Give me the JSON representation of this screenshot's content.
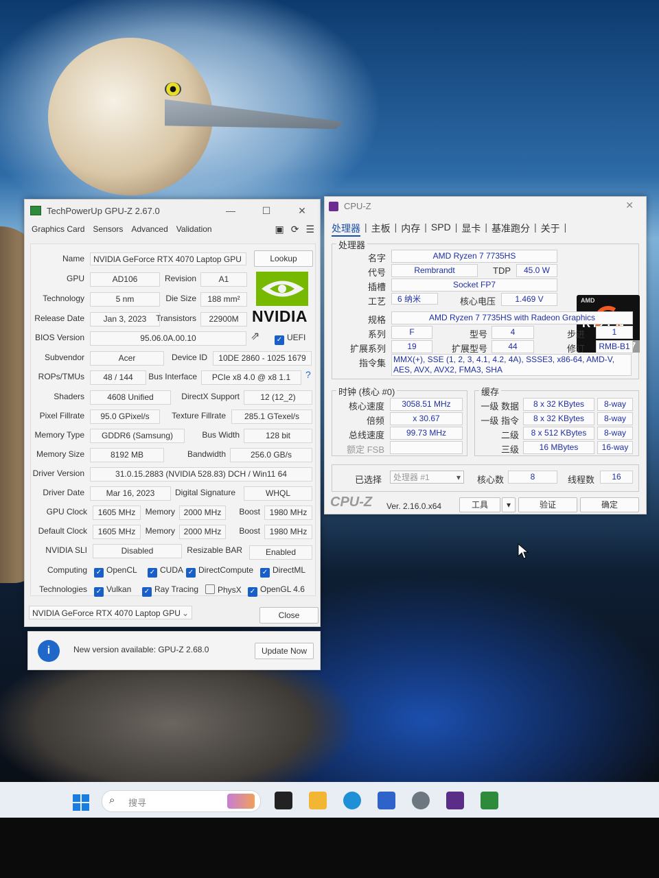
{
  "gpuz": {
    "title": "TechPowerUp GPU-Z 2.67.0",
    "tabs": [
      "Graphics Card",
      "Sensors",
      "Advanced",
      "Validation"
    ],
    "lookup_label": "Lookup",
    "name_label": "Name",
    "name": "NVIDIA GeForce RTX 4070 Laptop GPU",
    "gpu_label": "GPU",
    "gpu": "AD106",
    "revision_label": "Revision",
    "revision": "A1",
    "technology_label": "Technology",
    "technology": "5 nm",
    "die_size_label": "Die Size",
    "die_size": "188 mm²",
    "release_date_label": "Release Date",
    "release_date": "Jan 3, 2023",
    "transistors_label": "Transistors",
    "transistors": "22900M",
    "bios_label": "BIOS Version",
    "bios": "95.06.0A.00.10",
    "uefi_label": "UEFI",
    "subvendor_label": "Subvendor",
    "subvendor": "Acer",
    "device_id_label": "Device ID",
    "device_id": "10DE 2860 - 1025 1679",
    "rops_label": "ROPs/TMUs",
    "rops": "48 / 144",
    "bus_interface_label": "Bus Interface",
    "bus_interface": "PCIe x8 4.0 @ x8 1.1",
    "help": "?",
    "shaders_label": "Shaders",
    "shaders": "4608 Unified",
    "directx_label": "DirectX Support",
    "directx": "12 (12_2)",
    "pixel_fillrate_label": "Pixel Fillrate",
    "pixel_fillrate": "95.0 GPixel/s",
    "texture_fillrate_label": "Texture Fillrate",
    "texture_fillrate": "285.1 GTexel/s",
    "memory_type_label": "Memory Type",
    "memory_type": "GDDR6 (Samsung)",
    "bus_width_label": "Bus Width",
    "bus_width": "128 bit",
    "memory_size_label": "Memory Size",
    "memory_size": "8192 MB",
    "bandwidth_label": "Bandwidth",
    "bandwidth": "256.0 GB/s",
    "driver_version_label": "Driver Version",
    "driver_version": "31.0.15.2883 (NVIDIA 528.83) DCH / Win11 64",
    "driver_date_label": "Driver Date",
    "driver_date": "Mar 16, 2023",
    "digital_signature_label": "Digital Signature",
    "digital_signature": "WHQL",
    "gpu_clock_label": "GPU Clock",
    "gpu_clock": "1605 MHz",
    "memory_label": "Memory",
    "memory_clock": "2000 MHz",
    "boost_label": "Boost",
    "boost_clock": "1980 MHz",
    "default_clock_label": "Default Clock",
    "default_clock": "1605 MHz",
    "default_memory_clock": "2000 MHz",
    "default_boost_clock": "1980 MHz",
    "sli_label": "NVIDIA SLI",
    "sli": "Disabled",
    "resizable_bar_label": "Resizable BAR",
    "resizable_bar": "Enabled",
    "computing_label": "Computing",
    "technologies_label": "Technologies",
    "computing": [
      {
        "label": "OpenCL",
        "checked": true
      },
      {
        "label": "CUDA",
        "checked": true
      },
      {
        "label": "DirectCompute",
        "checked": true
      },
      {
        "label": "DirectML",
        "checked": true
      }
    ],
    "technologies": [
      {
        "label": "Vulkan",
        "checked": true
      },
      {
        "label": "Ray Tracing",
        "checked": true
      },
      {
        "label": "PhysX",
        "checked": false
      },
      {
        "label": "OpenGL 4.6",
        "checked": true
      }
    ],
    "selected_gpu": "NVIDIA GeForce RTX 4070 Laptop GPU",
    "close_label": "Close",
    "brand": "NVIDIA"
  },
  "notification": {
    "text": "New version available: GPU-Z 2.68.0",
    "button": "Update Now",
    "icon_glyph": "i"
  },
  "cpuz": {
    "title": "CPU-Z",
    "tabs": [
      "处理器",
      "主板",
      "内存",
      "SPD",
      "显卡",
      "基准跑分",
      "关于"
    ],
    "processor_group": "处理器",
    "name_label": "名字",
    "name": "AMD Ryzen 7 7735HS",
    "codename_label": "代号",
    "codename": "Rembrandt",
    "tdp_label": "TDP",
    "tdp": "45.0 W",
    "package_label": "插槽",
    "package": "Socket FP7",
    "technology_label": "工艺",
    "technology": "6 纳米",
    "voltage_label": "核心电压",
    "voltage": "1.469 V",
    "spec_label": "规格",
    "spec": "AMD Ryzen 7 7735HS with Radeon Graphics",
    "family_label": "系列",
    "family": "F",
    "model_label": "型号",
    "model": "4",
    "stepping_label": "步进",
    "stepping": "1",
    "ext_family_label": "扩展系列",
    "ext_family": "19",
    "ext_model_label": "扩展型号",
    "ext_model": "44",
    "revision_label": "修订",
    "revision": "RMB-B1",
    "instructions_label": "指令集",
    "instructions_line1": "MMX(+), SSE (1, 2, 3, 4.1, 4.2, 4A), SSSE3, x86-64, AMD-V,",
    "instructions_line2": "AES, AVX, AVX2, FMA3, SHA",
    "clocks_group": "时钟 (核心 #0)",
    "core_speed_label": "核心速度",
    "core_speed": "3058.51 MHz",
    "multiplier_label": "倍频",
    "multiplier": "x 30.67",
    "bus_speed_label": "总线速度",
    "bus_speed": "99.73 MHz",
    "rated_fsb_label": "额定 FSB",
    "rated_fsb": "",
    "cache_group": "缓存",
    "l1d_label": "一级 数据",
    "l1d": "8 x 32 KBytes",
    "l1d_way": "8-way",
    "l1i_label": "一级 指令",
    "l1i": "8 x 32 KBytes",
    "l1i_way": "8-way",
    "l2_label": "二级",
    "l2": "8 x 512 KBytes",
    "l2_way": "8-way",
    "l3_label": "三级",
    "l3": "16 MBytes",
    "l3_way": "16-way",
    "selection_label": "已选择",
    "selection": "处理器 #1",
    "cores_label": "核心数",
    "cores": "8",
    "threads_label": "线程数",
    "threads": "16",
    "brand": "CPU-Z",
    "version": "Ver. 2.16.0.x64",
    "tools_label": "工具",
    "validate_label": "验证",
    "ok_label": "确定",
    "logo_amd": "AMD",
    "logo_ryzen": "RYZEN",
    "logo_num": "7"
  },
  "taskbar": {
    "search_placeholder": "搜寻"
  },
  "colors": {
    "nvidia_green": "#76b900",
    "checkbox_blue": "#1a5fc8",
    "cpuz_blue": "#1f2fa5",
    "info_blue": "#1f67c9"
  }
}
